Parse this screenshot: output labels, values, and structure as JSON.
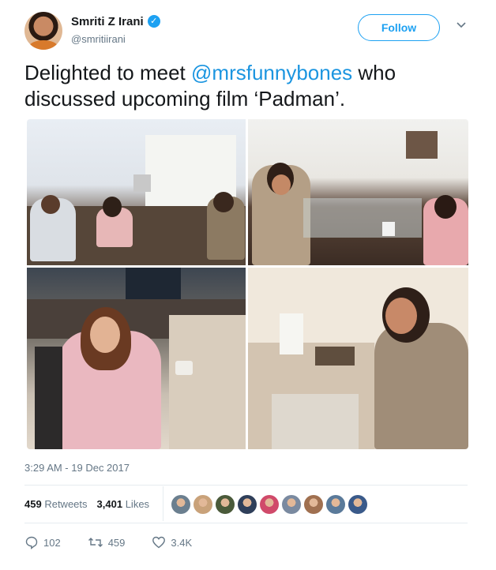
{
  "author": {
    "display_name": "Smriti Z Irani",
    "handle": "@smritiirani",
    "avatar_icon": "profile-avatar",
    "verified_icon": "verified-badge-icon"
  },
  "follow_button": {
    "label": "Follow"
  },
  "tweet": {
    "text_before": "Delighted to meet ",
    "mention": "@mrsfunnybones",
    "text_after": " who discussed upcoming film ‘Padman’."
  },
  "timestamp": "3:29 AM - 19 Dec 2017",
  "stats": {
    "retweets_count": "459",
    "retweets_label": "Retweets",
    "likes_count": "3,401",
    "likes_label": "Likes"
  },
  "liker_avatars": [
    "#6b7f8f",
    "#c9a27a",
    "#4a5a3a",
    "#2f3f5a",
    "#d04a6a",
    "#7a8aa0",
    "#a07050",
    "#5a7a9a",
    "#3a5a8a"
  ],
  "actions": {
    "reply_icon": "reply-icon",
    "reply_count": "102",
    "retweet_icon": "retweet-icon",
    "retweet_count": "459",
    "like_icon": "heart-icon",
    "like_count": "3.4K"
  },
  "colors": {
    "brand_blue": "#1da1f2",
    "mention_blue": "#1b95e0",
    "muted": "#657786",
    "text": "#14171a",
    "divider": "#e6ecf0"
  }
}
